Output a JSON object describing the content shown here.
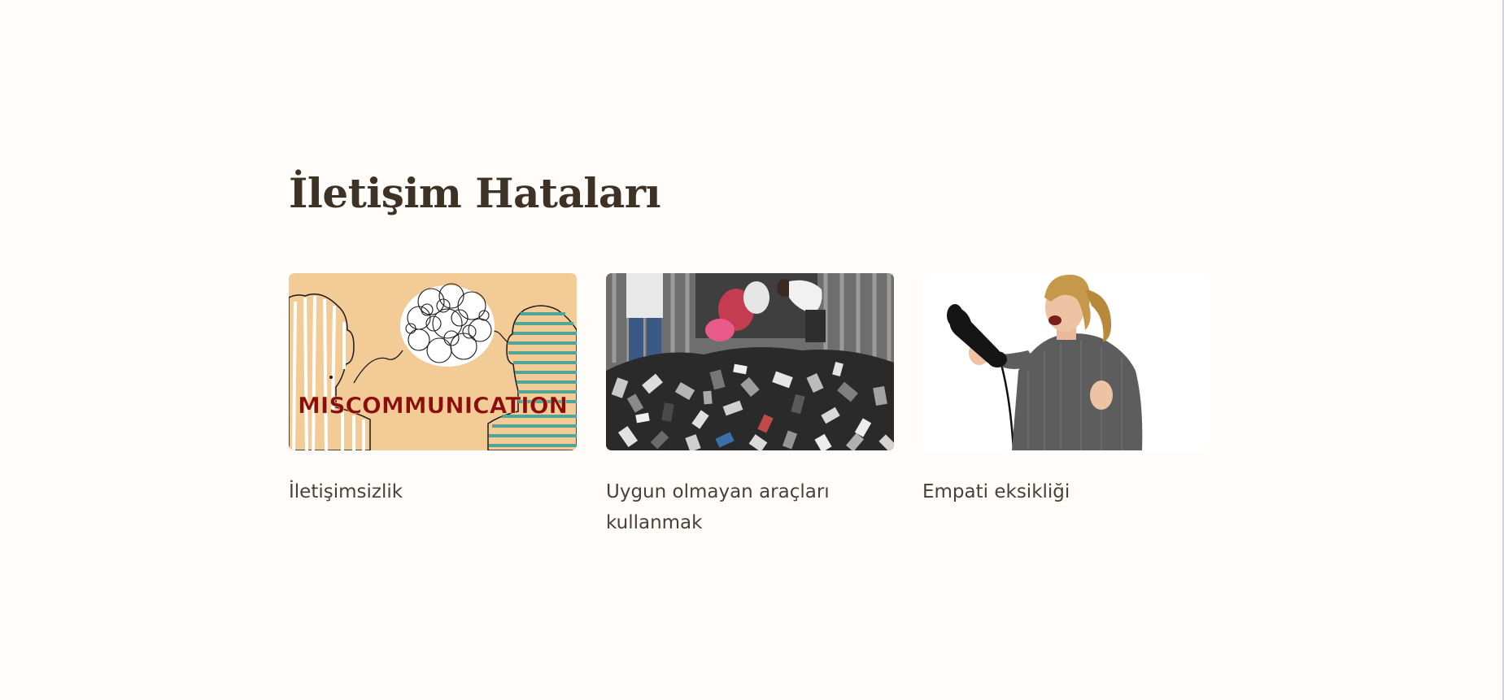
{
  "section": {
    "title": "İletişim Hataları"
  },
  "cards": [
    {
      "caption": "İletişimsizlik",
      "image_text": "MISCOMMUNICATION"
    },
    {
      "caption": "Uygun olmayan araçları kullanmak"
    },
    {
      "caption": "Empati eksikliği"
    }
  ],
  "colors": {
    "background": "#fffcf9",
    "title": "#3e3126",
    "caption": "#4b4038",
    "miscommunication_bg": "#f3cb97",
    "miscommunication_text": "#8b0d0d",
    "teal_stripes": "#4fa596"
  }
}
